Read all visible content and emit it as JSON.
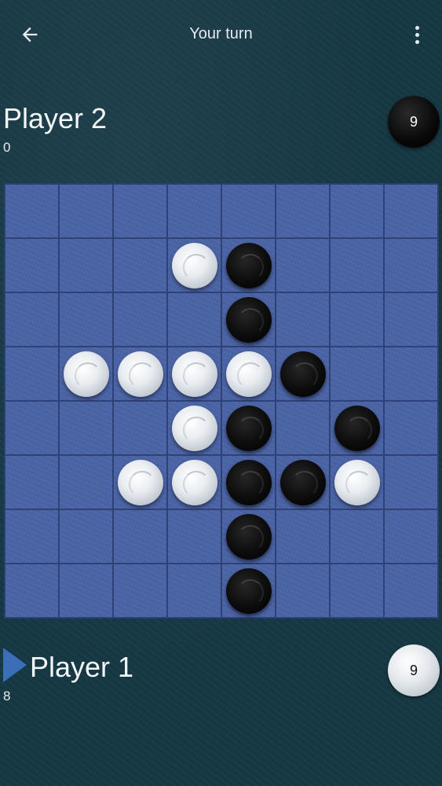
{
  "header": {
    "title": "Your turn",
    "back_icon": "arrow-left-icon",
    "menu_icon": "more-vertical-icon"
  },
  "player2": {
    "name": "Player 2",
    "score": "0",
    "disc_count": "9",
    "disc_color": "black"
  },
  "player1": {
    "name": "Player 1",
    "score": "8",
    "disc_count": "9",
    "disc_color": "white",
    "active": true
  },
  "board": {
    "size": 8,
    "rows": [
      "........",
      "...WB...",
      "....B...",
      ".WWWWB..",
      "...WB.B.",
      "..WWBBW.",
      "....B...",
      "....B..."
    ]
  },
  "colors": {
    "background": "#163844",
    "board": "#4b64a6",
    "turn_indicator": "#3a6fb8"
  }
}
